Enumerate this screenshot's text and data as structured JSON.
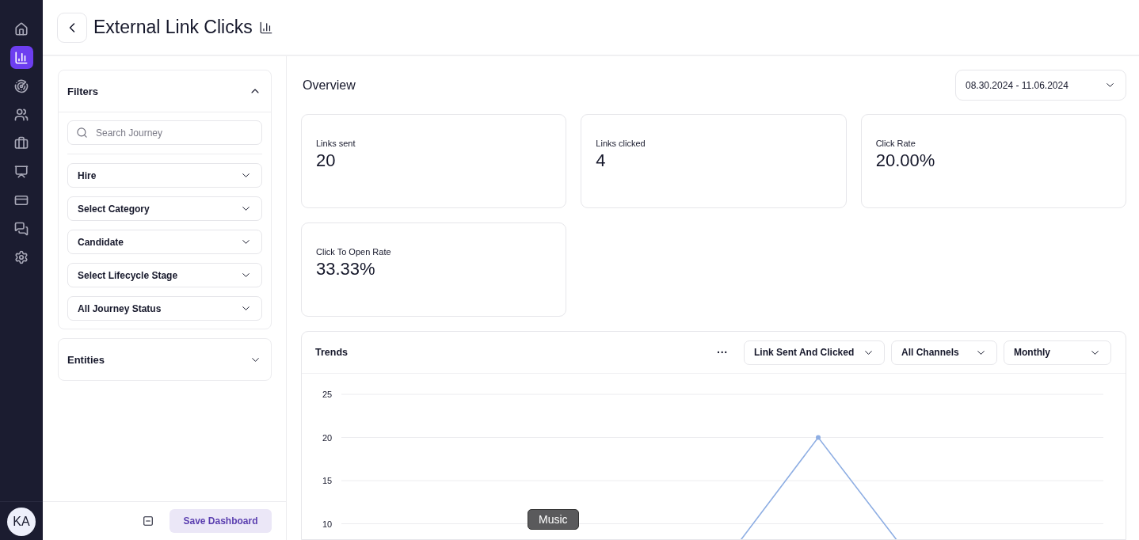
{
  "nav": [
    {
      "kind": "home",
      "selected": false
    },
    {
      "kind": "analytics",
      "selected": true
    },
    {
      "kind": "target",
      "selected": false
    },
    {
      "kind": "people",
      "selected": false
    },
    {
      "kind": "briefcase",
      "selected": false
    },
    {
      "kind": "team",
      "selected": false
    },
    {
      "kind": "card",
      "selected": false
    },
    {
      "kind": "chat",
      "selected": false
    },
    {
      "kind": "settings",
      "selected": false
    }
  ],
  "avatar": "KA",
  "header": {
    "title": "External Link Clicks"
  },
  "filters": {
    "title": "Filters",
    "expanded": true,
    "search_placeholder": "Search Journey",
    "dropdowns": [
      "Hire",
      "Select Category",
      "Candidate",
      "Select Lifecycle Stage",
      "All Journey Status"
    ]
  },
  "entities": {
    "title": "Entities",
    "expanded": false
  },
  "footer": {
    "save_button": "Save Dashboard"
  },
  "overview": {
    "title": "Overview",
    "date_range": "08.30.2024 - 11.06.2024",
    "stats": [
      {
        "label": "Links sent",
        "value": "20"
      },
      {
        "label": "Links clicked",
        "value": "4"
      },
      {
        "label": "Click Rate",
        "value": "20.00%"
      },
      {
        "label": "Click To Open Rate",
        "value": "33.33%"
      }
    ]
  },
  "trends": {
    "title": "Trends",
    "more": "···",
    "dropdowns": [
      "Link Sent And Clicked",
      "All Channels",
      "Monthly"
    ],
    "y_axis_labels": [
      "25",
      "20",
      "15",
      "10"
    ]
  },
  "tooltip": "Music"
}
